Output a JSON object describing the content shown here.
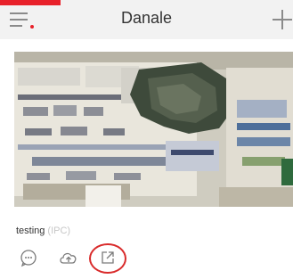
{
  "header": {
    "title": "Danale",
    "menu_icon": "menu-icon",
    "add_icon": "plus-icon",
    "accent_color": "#e8212a"
  },
  "device": {
    "name": "testing",
    "type": "(IPC)"
  },
  "actions": [
    {
      "icon": "message-icon"
    },
    {
      "icon": "cloud-upload-icon"
    },
    {
      "icon": "share-icon",
      "highlighted": true
    }
  ]
}
